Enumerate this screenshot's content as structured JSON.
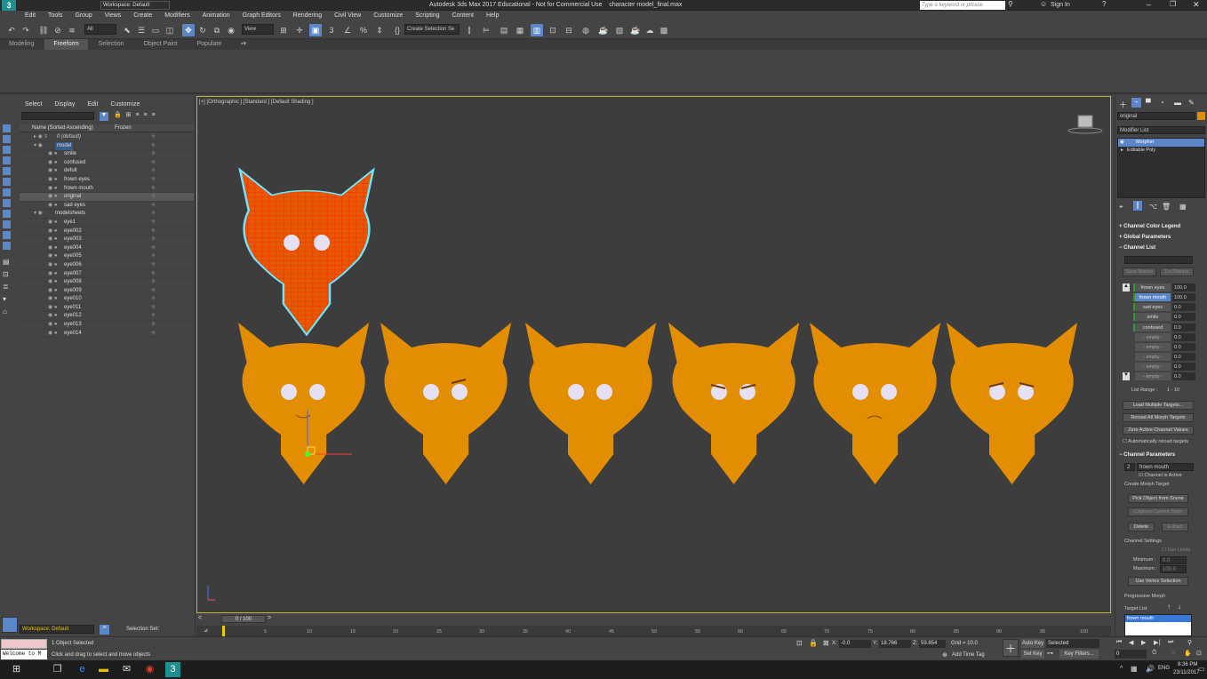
{
  "title": {
    "workspace": "Workspace: Default",
    "window_title": "Autodesk 3ds Max 2017 Educational - Not for Commercial Use    character model_final.max",
    "search_placeholder": "Type a keyword or phrase",
    "sign_in": "Sign In"
  },
  "menu": [
    "Edit",
    "Tools",
    "Group",
    "Views",
    "Create",
    "Modifiers",
    "Animation",
    "Graph Editors",
    "Rendering",
    "Civil View",
    "Customize",
    "Scripting",
    "Content",
    "Help"
  ],
  "toolbar": {
    "filter_all": "All",
    "view": "View",
    "create_selection_set": "Create Selection Se"
  },
  "ribbon_tabs": [
    "Modeling",
    "Freeform",
    "Selection",
    "Object Paint",
    "Populate"
  ],
  "ribbon_active": "Freeform",
  "scene_explorer": {
    "menu": [
      "Select",
      "Display",
      "Edit",
      "Customize"
    ],
    "col_name": "Name (Sorted Ascending)",
    "col_frozen": "Frozen",
    "rows": [
      "0 (default)",
      "model",
      "smile",
      "confused",
      "defult",
      "frown eyes",
      "frown mouth",
      "original",
      "sad eyes",
      "modelsheets",
      "eye1",
      "eye002",
      "eye003",
      "eye004",
      "eye005",
      "eye006",
      "eye007",
      "eye008",
      "eye009",
      "eye010",
      "eye011",
      "eye012",
      "eye013",
      "eye014"
    ]
  },
  "viewport": {
    "label": "[+] [Orthographic ] [Standard ] [Default Shading ]"
  },
  "command_panel": {
    "object_name": "original",
    "modifier_list": "Modifier List",
    "stack": [
      "Morpher",
      "Editable Poly"
    ],
    "rollouts": [
      "Channel Color Legend",
      "Global Parameters",
      "Channel List"
    ],
    "save_marker": "Save Marker",
    "del_marker": "Del Marker",
    "channels": [
      {
        "name": "frown eyes",
        "value": "100.0"
      },
      {
        "name": "frown mouth",
        "value": "100.0"
      },
      {
        "name": "sad eyes",
        "value": "0.0"
      },
      {
        "name": "smile",
        "value": "0.0"
      },
      {
        "name": "confused",
        "value": "0.0"
      },
      {
        "name": "- empty -",
        "value": "0.0"
      },
      {
        "name": "- empty -",
        "value": "0.0"
      },
      {
        "name": "- empty -",
        "value": "0.0"
      },
      {
        "name": "- empty -",
        "value": "0.0"
      },
      {
        "name": "- empty -",
        "value": "0.0"
      }
    ],
    "list_range": "List Range :",
    "list_range_value": "1 - 10",
    "load_multiple": "Load Multiple Targets...",
    "reload_all": "Reload All Morph Targets",
    "zero_active": "Zero Active Channel Values",
    "auto_reload": "Automatically reload targets",
    "channel_parameters": "Channel Parameters",
    "channel_number": "2",
    "channel_name": "frown mouth",
    "channel_active": "Channel is Active",
    "create_morph_target": "Create Morph Target",
    "pick_object": "Pick Object from Scene",
    "capture_state": "Capture Current State",
    "delete": "Delete",
    "extract": "Extract",
    "channel_settings": "Channel Settings",
    "use_limits": "Use Limits",
    "minimum": "Minimum :",
    "minimum_value": "0.0",
    "maximum": "Maximum :",
    "maximum_value": "100.0",
    "use_vertex_selection": "Use Vertex Selection",
    "progressive_morph": "Progressive Morph",
    "target_list": "Target List",
    "target_item": "frown mouth"
  },
  "timeline": {
    "slider": "0 / 100",
    "ticks": [
      "0",
      "5",
      "10",
      "15",
      "20",
      "25",
      "30",
      "35",
      "40",
      "45",
      "50",
      "55",
      "60",
      "65",
      "70",
      "75",
      "80",
      "85",
      "90",
      "95",
      "100"
    ]
  },
  "status": {
    "workspace": "Workspace: Default",
    "selection_set": "Selection Set:",
    "maxscript": "Welcome to M",
    "objects_selected": "1 Object Selected",
    "prompt": "Click and drag to select and move objects",
    "x_label": "X:",
    "x": "-0.0",
    "y_label": "Y:",
    "y": "18.766",
    "z_label": "Z:",
    "z": "59.854",
    "grid": "Grid = 10.0",
    "add_time_tag": "Add Time Tag",
    "auto_key": "Auto Key",
    "selected": "Selected",
    "set_key": "Set Key",
    "key_filters": "Key Filters...",
    "frame": "0"
  },
  "taskbar": {
    "time": "8:36 PM",
    "date": "23/11/2017",
    "lang": "ENG"
  },
  "colors": {
    "accent": "#5b87c9",
    "viewport_border": "#c8b03a",
    "head_fill": "#e38d00",
    "wire": "#ff3300",
    "selection_outline": "#6fe6ff"
  }
}
